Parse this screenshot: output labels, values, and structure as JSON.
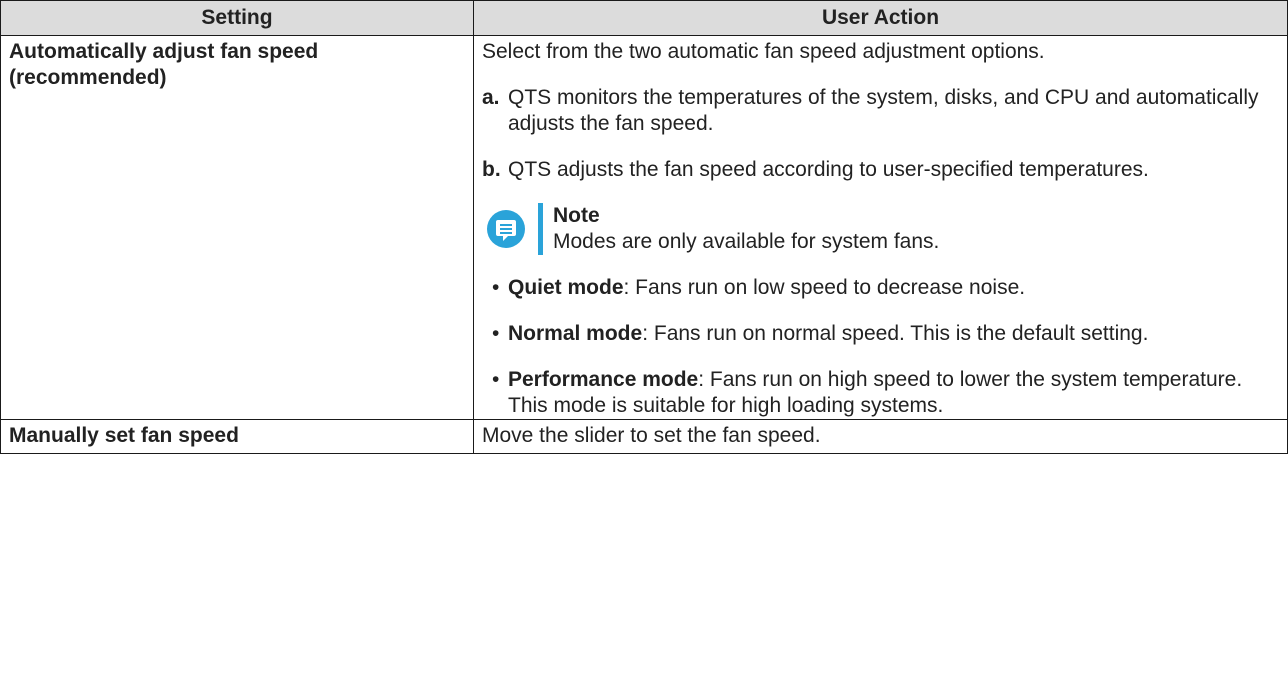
{
  "table": {
    "headers": {
      "setting": "Setting",
      "action": "User Action"
    },
    "rows": [
      {
        "setting": "Automatically adjust fan speed (recommended)",
        "intro": "Select from the two automatic fan speed adjustment options.",
        "lettered": [
          {
            "mark": "a.",
            "text": "QTS monitors the temperatures of the system, disks, and CPU and automatically adjusts the fan speed."
          },
          {
            "mark": "b.",
            "text": "QTS adjusts the fan speed according to user-specified temperatures."
          }
        ],
        "note": {
          "title": "Note",
          "text": "Modes are only available for system fans.",
          "icon": "note-icon",
          "accent": "#2aa3d9"
        },
        "bullets": [
          {
            "term": "Quiet mode",
            "text": ": Fans run on low speed to decrease noise."
          },
          {
            "term": "Normal mode",
            "text": ": Fans run on normal speed. This is the default setting."
          },
          {
            "term": "Performance mode",
            "text": ": Fans run on high speed to lower the system temperature. This mode is suitable for high loading systems."
          }
        ]
      },
      {
        "setting": "Manually set fan speed",
        "intro": "Move the slider to set the fan speed."
      }
    ]
  }
}
